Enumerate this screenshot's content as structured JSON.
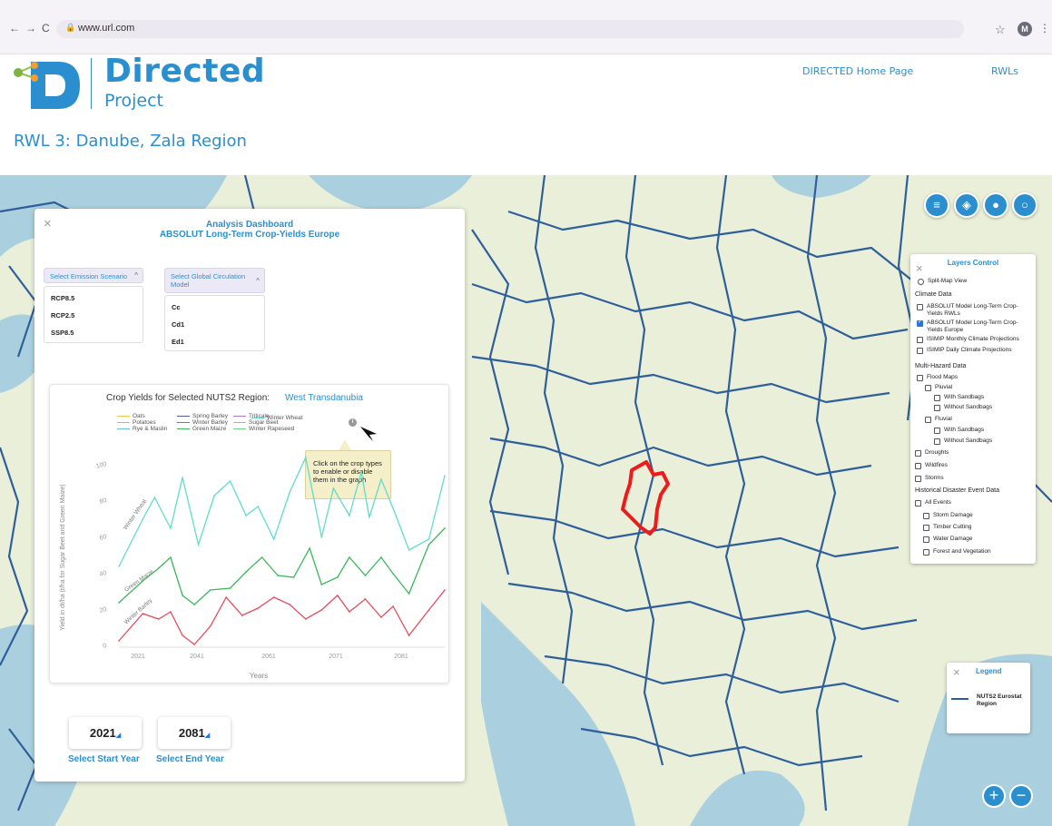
{
  "browser": {
    "url": "www.url.com",
    "avatar_letter": "M",
    "back": "←",
    "forward": "→",
    "reload": "C",
    "bookmark": "☆",
    "menu": "⋮"
  },
  "header": {
    "brand_title": "Directed",
    "brand_subtitle": "Project",
    "nav": [
      "DIRECTED Home Page",
      "RWLs"
    ]
  },
  "page_title": "RWL 3: Danube, Zala Region",
  "dashboard": {
    "title_line1": "Analysis Dashboard",
    "title_line2": "ABSOLUT Long-Term Crop-Yields Europe",
    "close": "×",
    "emission": {
      "label": "Select Emission Scenario",
      "options": [
        "RCP8.5",
        "RCP2.5",
        "SSP8.5"
      ]
    },
    "gcm": {
      "label_line1": "Select Global Circulation",
      "label_line2": "Model",
      "options": [
        "Cc",
        "Cd1",
        "Ed1"
      ]
    },
    "chevron": "^",
    "tooltip": "Click on the crop types to enable or disable them in the graph",
    "info": "i",
    "start_year": "2021",
    "end_year": "2081",
    "start_label": "Select Start Year",
    "end_label": "Select End Year"
  },
  "chart_data": {
    "type": "line",
    "title": "Crop Yields for Selected NUTS2 Region:",
    "region": "West Transdanubia",
    "xlabel": "Years",
    "ylabel": "Yield in dt/ha (t/ha for Sugar Beet and Green Maize)",
    "x_ticks": [
      "2021",
      "2041",
      "2061",
      "2071",
      "2081"
    ],
    "y_ticks": [
      0,
      20,
      40,
      60,
      80,
      100
    ],
    "ylim": [
      0,
      100
    ],
    "xlim": [
      2016,
      2098
    ],
    "legend": [
      {
        "name": "Oats",
        "color": "#e6c84b"
      },
      {
        "name": "Spring Barley",
        "color": "#4a5ea8"
      },
      {
        "name": "Triticale",
        "color": "#b07ad6"
      },
      {
        "name": "Winter Wheat",
        "color": "#5fdccc"
      },
      {
        "name": "Potatoes",
        "color": "#e0a090"
      },
      {
        "name": "Winter Barley",
        "color": "#e64a5a"
      },
      {
        "name": "Sugar Beet",
        "color": "#d98ed9"
      },
      {
        "name": "Rye & Maslin",
        "color": "#5fc4d0"
      },
      {
        "name": "Green Maize",
        "color": "#3ab858"
      },
      {
        "name": "Winter Rapeseed",
        "color": "#6cd68a"
      }
    ],
    "series": [
      {
        "name": "Winter Wheat",
        "color": "#5fdccc",
        "inline_label": "Winter Wheat",
        "x": [
          2016,
          2022,
          2025,
          2029,
          2032,
          2036,
          2040,
          2044,
          2048,
          2051,
          2055,
          2059,
          2063,
          2067,
          2070,
          2074,
          2077,
          2079,
          2082,
          2085,
          2089,
          2094,
          2098
        ],
        "y": [
          43,
          69,
          81,
          64,
          92,
          55,
          82,
          90,
          71,
          76,
          58,
          84,
          103,
          59,
          86,
          71,
          95,
          70,
          91,
          75,
          52,
          58,
          93
        ]
      },
      {
        "name": "Green Maize",
        "color": "#3ab858",
        "inline_label": "Green Maize",
        "x": [
          2016,
          2022,
          2026,
          2029,
          2032,
          2035,
          2039,
          2044,
          2048,
          2052,
          2056,
          2060,
          2064,
          2067,
          2071,
          2074,
          2078,
          2082,
          2085,
          2089,
          2094,
          2098
        ],
        "y": [
          23,
          35,
          42,
          48,
          27,
          22,
          30,
          31,
          40,
          48,
          38,
          37,
          53,
          33,
          37,
          48,
          38,
          48,
          39,
          28,
          55,
          64
        ]
      },
      {
        "name": "Winter Barley",
        "color": "#e64a5a",
        "inline_label": "Winter Barley",
        "x": [
          2016,
          2022,
          2026,
          2029,
          2032,
          2035,
          2039,
          2043,
          2047,
          2051,
          2055,
          2059,
          2063,
          2067,
          2071,
          2074,
          2078,
          2082,
          2085,
          2089,
          2094,
          2098
        ],
        "y": [
          2,
          17,
          14,
          18,
          5,
          0,
          10,
          26,
          16,
          20,
          26,
          22,
          14,
          19,
          27,
          18,
          25,
          15,
          21,
          5,
          19,
          30
        ]
      }
    ]
  },
  "layers_control": {
    "title": "Layers Control",
    "close": "×",
    "split_map": "Split-Map View",
    "climate_header": "Climate Data",
    "climate_items": [
      {
        "label": "ABSOLUT Model Long-Term Crop-Yields RWLs",
        "checked": false
      },
      {
        "label": "ABSOLUT Model Long-Term Crop-Yields Europe",
        "checked": true
      },
      {
        "label": "ISIMIP Monthly Climate Projections",
        "checked": false
      },
      {
        "label": "ISIMIP Daily Climate Projections",
        "checked": false
      }
    ],
    "hazard_header": "Multi-Hazard Data",
    "flood_maps": "Flood Maps",
    "pluvial": "Pluvial",
    "fluvial": "Fluvial",
    "with_sandbags": "With Sandbags",
    "without_sandbags": "Without Sandbags",
    "droughts": "Droughts",
    "wildfires": "Wildfires",
    "storms": "Storms",
    "historical_header": "Historical Disaster Event Data",
    "all_events": "All Events",
    "historical_items": [
      "Storm Damage",
      "Timber Cutting",
      "Water Damage",
      "Forest and Vegetation"
    ]
  },
  "legend": {
    "title": "Legend",
    "close": "×",
    "item": "NUTS2 Eurostat Region",
    "line_color": "#2f5f9a"
  },
  "map_controls": {
    "menu_icon": "≡",
    "layers_icon": "◈",
    "location_icon": "●",
    "search_icon": "○",
    "zoom_in": "+",
    "zoom_out": "−"
  }
}
